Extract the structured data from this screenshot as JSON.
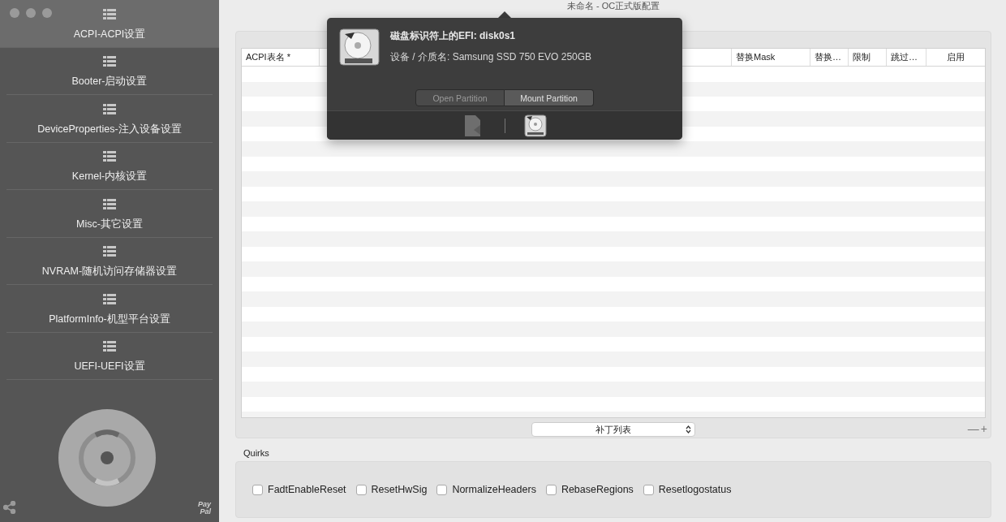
{
  "window": {
    "title": "未命名 - OC正式版配置"
  },
  "sidebar": {
    "items": [
      {
        "label": "ACPI-ACPI设置",
        "selected": true
      },
      {
        "label": "Booter-启动设置",
        "selected": false
      },
      {
        "label": "DeviceProperties-注入设备设置",
        "selected": false
      },
      {
        "label": "Kernel-内核设置",
        "selected": false
      },
      {
        "label": "Misc-其它设置",
        "selected": false
      },
      {
        "label": "NVRAM-随机访问存储器设置",
        "selected": false
      },
      {
        "label": "PlatformInfo-机型平台设置",
        "selected": false
      },
      {
        "label": "UEFI-UEFI设置",
        "selected": false
      }
    ],
    "paypal": [
      "Pay",
      "Pal"
    ]
  },
  "table": {
    "columns": [
      "ACPI表名 *",
      "替换Mask",
      "替换…",
      "限制",
      "跳过…",
      "启用"
    ]
  },
  "patch_list_select": {
    "value": "补丁列表"
  },
  "list_controls": [
    "—",
    "+"
  ],
  "quirks": {
    "title": "Quirks",
    "items": [
      {
        "label": "FadtEnableReset",
        "checked": false
      },
      {
        "label": "ResetHwSig",
        "checked": false
      },
      {
        "label": "NormalizeHeaders",
        "checked": false
      },
      {
        "label": "RebaseRegions",
        "checked": false
      },
      {
        "label": "Resetlogostatus",
        "checked": false
      }
    ]
  },
  "popover": {
    "title": "磁盘标识符上的EFI: disk0s1",
    "device": "设备 / 介质名: Samsung SSD 750 EVO 250GB",
    "buttons": [
      {
        "label": "Open Partition",
        "disabled": true
      },
      {
        "label": "Mount Partition",
        "disabled": false
      }
    ]
  }
}
